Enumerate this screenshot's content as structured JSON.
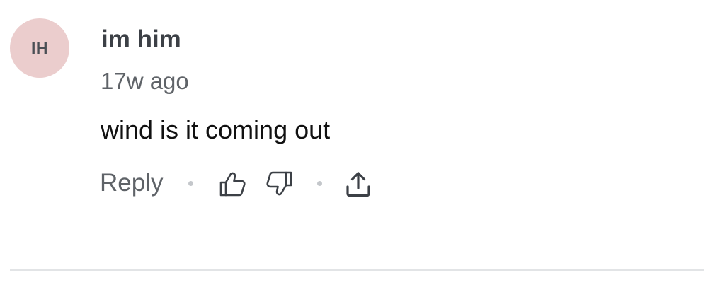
{
  "comment": {
    "avatar_initials": "IH",
    "avatar_color": "#ebcdcd",
    "username": "im him",
    "timestamp": "17w ago",
    "text": "wind is it coming out"
  },
  "actions": {
    "reply_label": "Reply",
    "like_icon": "thumbs-up-icon",
    "dislike_icon": "thumbs-down-icon",
    "share_icon": "share-icon"
  }
}
